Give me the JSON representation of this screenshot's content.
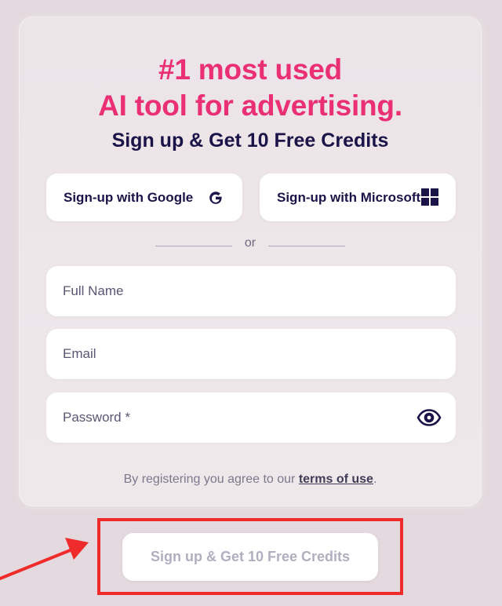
{
  "hero": {
    "line_1": "#1 most used",
    "line_2": "AI tool for advertising.",
    "subheading": "Sign up & Get 10 Free Credits"
  },
  "social": {
    "google_label": "Sign-up with Google",
    "microsoft_label": "Sign-up with Microsoft",
    "google_icon": "google-g-icon",
    "microsoft_icon": "microsoft-windows-icon"
  },
  "divider": {
    "text": "or"
  },
  "form": {
    "full_name": {
      "value": "",
      "placeholder": "Full Name"
    },
    "email": {
      "value": "",
      "placeholder": "Email"
    },
    "password": {
      "value": "",
      "placeholder": "Password *",
      "toggle_icon": "eye-icon"
    }
  },
  "terms": {
    "prefix": "By registering you agree to our ",
    "link": "terms of use",
    "suffix": "."
  },
  "cta": {
    "label": "Sign up & Get 10 Free Credits"
  },
  "annotation": {
    "highlight_color": "#ef2b2b",
    "arrow_color": "#ef2b2b"
  },
  "colors": {
    "accent": "#ea2f74",
    "heading": "#1a1448",
    "page_background": "#e3d9de",
    "card_background": "#ede5e8",
    "disabled_button_text": "#b2aec0"
  }
}
